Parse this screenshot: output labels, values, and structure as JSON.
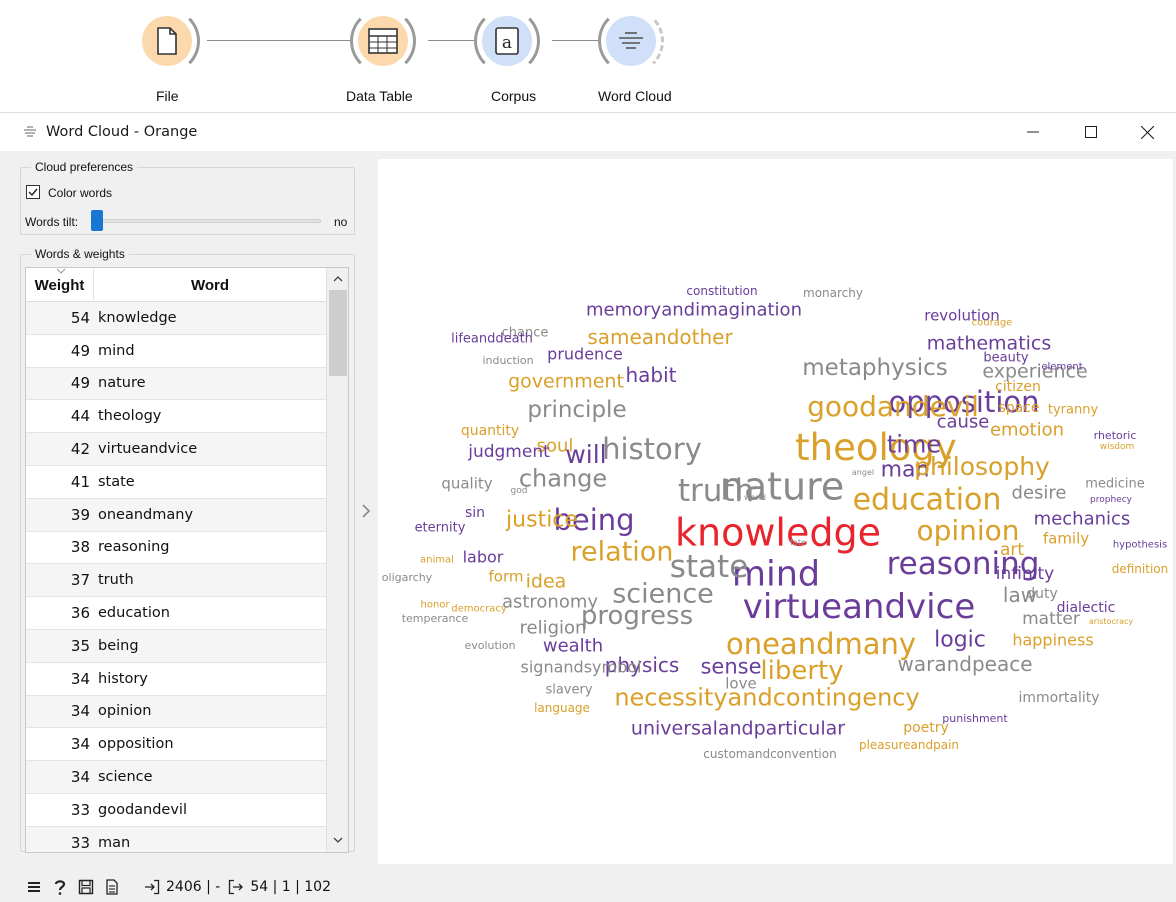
{
  "workflow": {
    "nodes": [
      {
        "label": "File",
        "icon": "file-icon",
        "color": "#fcd9ad"
      },
      {
        "label": "Data Table",
        "icon": "table-icon",
        "color": "#fcd9ad"
      },
      {
        "label": "Corpus",
        "icon": "corpus-icon",
        "color": "#cfe0f8"
      },
      {
        "label": "Word Cloud",
        "icon": "word-cloud-icon",
        "color": "#cfe0f8"
      }
    ]
  },
  "window": {
    "title": "Word Cloud - Orange",
    "controls": {
      "minimize": "minimize-icon",
      "maximize": "maximize-icon",
      "close": "close-icon"
    }
  },
  "cloud_preferences": {
    "group_title": "Cloud preferences",
    "color_words_label": "Color words",
    "color_words_checked": true,
    "words_tilt_label": "Words tilt:",
    "words_tilt_value_text": "no",
    "words_tilt_level": 0
  },
  "words_weights": {
    "group_title": "Words & weights",
    "columns": [
      "Weight",
      "Word"
    ],
    "rows": [
      {
        "weight": "54",
        "word": "knowledge"
      },
      {
        "weight": "49",
        "word": "mind"
      },
      {
        "weight": "49",
        "word": "nature"
      },
      {
        "weight": "44",
        "word": "theology"
      },
      {
        "weight": "42",
        "word": "virtueandvice"
      },
      {
        "weight": "41",
        "word": "state"
      },
      {
        "weight": "39",
        "word": "oneandmany"
      },
      {
        "weight": "38",
        "word": "reasoning"
      },
      {
        "weight": "37",
        "word": "truth"
      },
      {
        "weight": "36",
        "word": "education"
      },
      {
        "weight": "35",
        "word": "being"
      },
      {
        "weight": "34",
        "word": "history"
      },
      {
        "weight": "34",
        "word": "opinion"
      },
      {
        "weight": "34",
        "word": "opposition"
      },
      {
        "weight": "34",
        "word": "science"
      },
      {
        "weight": "33",
        "word": "goodandevil"
      },
      {
        "weight": "33",
        "word": "man"
      }
    ]
  },
  "colors": {
    "red": "#e8242c",
    "purple": "#6a3d9a",
    "gold": "#d9a02a",
    "gray": "#8a8a8a",
    "blue_accent": "#1976d2"
  },
  "cloud_words": [
    {
      "t": "knowledge",
      "c": "red"
    },
    {
      "t": "mind",
      "c": "purple"
    },
    {
      "t": "nature",
      "c": "gray"
    },
    {
      "t": "theology",
      "c": "gold"
    },
    {
      "t": "virtueandvice",
      "c": "purple"
    },
    {
      "t": "state",
      "c": "gray"
    },
    {
      "t": "oneandmany",
      "c": "gold"
    },
    {
      "t": "reasoning",
      "c": "purple"
    },
    {
      "t": "truth",
      "c": "gray"
    },
    {
      "t": "education",
      "c": "gold"
    },
    {
      "t": "being",
      "c": "purple"
    },
    {
      "t": "history",
      "c": "gray"
    },
    {
      "t": "opinion",
      "c": "gold"
    },
    {
      "t": "opposition",
      "c": "purple"
    },
    {
      "t": "science",
      "c": "gray"
    },
    {
      "t": "goodandevil",
      "c": "gold"
    },
    {
      "t": "man",
      "c": "purple"
    },
    {
      "t": "relation",
      "c": "gold"
    },
    {
      "t": "progress",
      "c": "gray"
    },
    {
      "t": "liberty",
      "c": "gold"
    },
    {
      "t": "philosophy",
      "c": "gold"
    },
    {
      "t": "necessityandcontingency",
      "c": "gold"
    },
    {
      "t": "metaphysics",
      "c": "gray"
    },
    {
      "t": "change",
      "c": "gray"
    },
    {
      "t": "time",
      "c": "purple"
    },
    {
      "t": "principle",
      "c": "gray"
    },
    {
      "t": "justice",
      "c": "gold"
    },
    {
      "t": "logic",
      "c": "purple"
    },
    {
      "t": "sense",
      "c": "purple"
    },
    {
      "t": "will",
      "c": "purple"
    },
    {
      "t": "sameandother",
      "c": "gold"
    },
    {
      "t": "habit",
      "c": "purple"
    },
    {
      "t": "experience",
      "c": "gray"
    },
    {
      "t": "government",
      "c": "gold"
    },
    {
      "t": "mathematics",
      "c": "purple"
    },
    {
      "t": "universalandparticular",
      "c": "purple"
    },
    {
      "t": "warandpeace",
      "c": "gray"
    },
    {
      "t": "physics",
      "c": "purple"
    },
    {
      "t": "law",
      "c": "gray"
    },
    {
      "t": "emotion",
      "c": "gold"
    },
    {
      "t": "desire",
      "c": "gray"
    },
    {
      "t": "mechanics",
      "c": "purple"
    },
    {
      "t": "infinity",
      "c": "purple"
    },
    {
      "t": "matter",
      "c": "gray"
    },
    {
      "t": "happiness",
      "c": "gold"
    },
    {
      "t": "wealth",
      "c": "purple"
    },
    {
      "t": "religion",
      "c": "gray"
    },
    {
      "t": "astronomy",
      "c": "gray"
    },
    {
      "t": "idea",
      "c": "gold"
    },
    {
      "t": "soul",
      "c": "gold"
    },
    {
      "t": "judgment",
      "c": "purple"
    },
    {
      "t": "art",
      "c": "gold"
    },
    {
      "t": "cause",
      "c": "purple"
    },
    {
      "t": "memoryandimagination",
      "c": "purple"
    },
    {
      "t": "revolution",
      "c": "purple"
    },
    {
      "t": "prudence",
      "c": "purple"
    },
    {
      "t": "signandsymbol",
      "c": "gray"
    },
    {
      "t": "family",
      "c": "gold"
    },
    {
      "t": "space",
      "c": "gold"
    },
    {
      "t": "immortality",
      "c": "gray"
    },
    {
      "t": "dialectic",
      "c": "purple"
    },
    {
      "t": "duty",
      "c": "gray"
    },
    {
      "t": "love",
      "c": "gray"
    },
    {
      "t": "quality",
      "c": "gray"
    },
    {
      "t": "labor",
      "c": "purple"
    },
    {
      "t": "form",
      "c": "gold"
    },
    {
      "t": "citizen",
      "c": "gold"
    },
    {
      "t": "poetry",
      "c": "gold"
    },
    {
      "t": "beauty",
      "c": "purple"
    },
    {
      "t": "quantity",
      "c": "gold"
    },
    {
      "t": "medicine",
      "c": "gray"
    },
    {
      "t": "slavery",
      "c": "gray"
    },
    {
      "t": "sin",
      "c": "purple"
    },
    {
      "t": "eternity",
      "c": "purple"
    },
    {
      "t": "tyranny",
      "c": "gold"
    },
    {
      "t": "chance",
      "c": "gray"
    },
    {
      "t": "lifeanddeath",
      "c": "purple"
    },
    {
      "t": "constitution",
      "c": "purple"
    },
    {
      "t": "monarchy",
      "c": "gray"
    },
    {
      "t": "customandconvention",
      "c": "gray"
    },
    {
      "t": "pleasureandpain",
      "c": "gold"
    },
    {
      "t": "punishment",
      "c": "purple"
    },
    {
      "t": "language",
      "c": "gold"
    },
    {
      "t": "evolution",
      "c": "gray"
    },
    {
      "t": "temperance",
      "c": "gray"
    },
    {
      "t": "oligarchy",
      "c": "gray"
    },
    {
      "t": "honor",
      "c": "gold"
    },
    {
      "t": "democracy",
      "c": "gold"
    },
    {
      "t": "animal",
      "c": "gold"
    },
    {
      "t": "induction",
      "c": "gray"
    },
    {
      "t": "courage",
      "c": "gold"
    },
    {
      "t": "element",
      "c": "purple"
    },
    {
      "t": "rhetoric",
      "c": "purple"
    },
    {
      "t": "wisdom",
      "c": "gold"
    },
    {
      "t": "prophecy",
      "c": "purple"
    },
    {
      "t": "hypothesis",
      "c": "purple"
    },
    {
      "t": "definition",
      "c": "gold"
    },
    {
      "t": "aristocracy",
      "c": "gold"
    },
    {
      "t": "god",
      "c": "gray"
    },
    {
      "t": "angel",
      "c": "gray"
    },
    {
      "t": "world",
      "c": "gray"
    },
    {
      "t": "fate",
      "c": "gray"
    }
  ],
  "statusbar": {
    "icons": [
      "menu-icon",
      "help-icon",
      "save-icon",
      "report-icon"
    ],
    "input_summary": "2406 | -",
    "output_summary": "54 | 1 | 102"
  }
}
